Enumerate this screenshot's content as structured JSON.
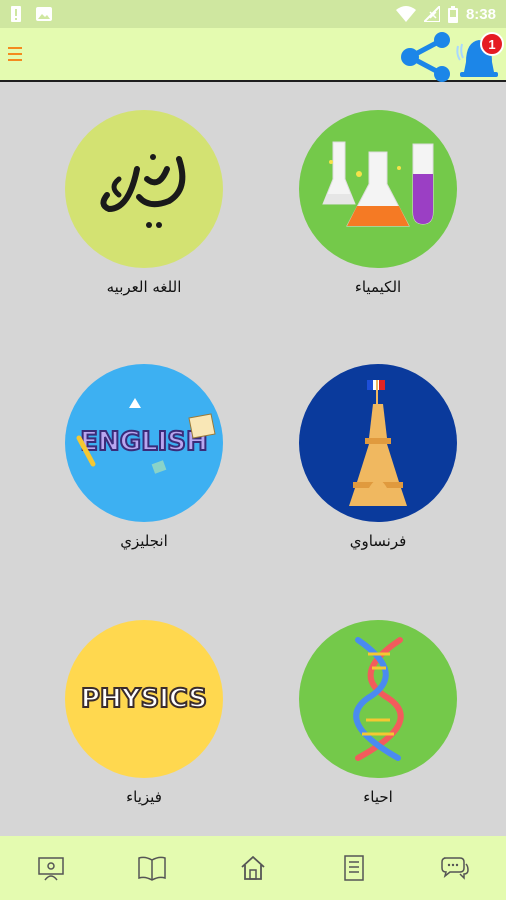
{
  "status": {
    "time": "8:38"
  },
  "header": {
    "notification_count": "1"
  },
  "subjects": [
    {
      "label": "الكيمياء",
      "icon": "chemistry-flasks-icon",
      "color": "#74c94a"
    },
    {
      "label": "اللغه العربيه",
      "icon": "arabic-calligraphy-icon",
      "color": "#d3e272"
    },
    {
      "label": "فرنساوي",
      "icon": "eiffel-tower-icon",
      "color": "#0a3a9c"
    },
    {
      "label": "انجليزي",
      "icon": "english-icon",
      "color": "#3db0f2",
      "art_text": "ENGLISH"
    },
    {
      "label": "احياء",
      "icon": "dna-helix-icon",
      "color": "#74c94a"
    },
    {
      "label": "فيزياء",
      "icon": "physics-icon",
      "color": "#ffd84f",
      "art_text": "PHYSICS"
    }
  ],
  "bottom_nav": [
    {
      "name": "nav-teacher",
      "icon": "teacher-board-icon"
    },
    {
      "name": "nav-book",
      "icon": "open-book-icon"
    },
    {
      "name": "nav-home",
      "icon": "home-icon"
    },
    {
      "name": "nav-notes",
      "icon": "notes-icon"
    },
    {
      "name": "nav-chat",
      "icon": "chat-bubbles-icon"
    }
  ]
}
